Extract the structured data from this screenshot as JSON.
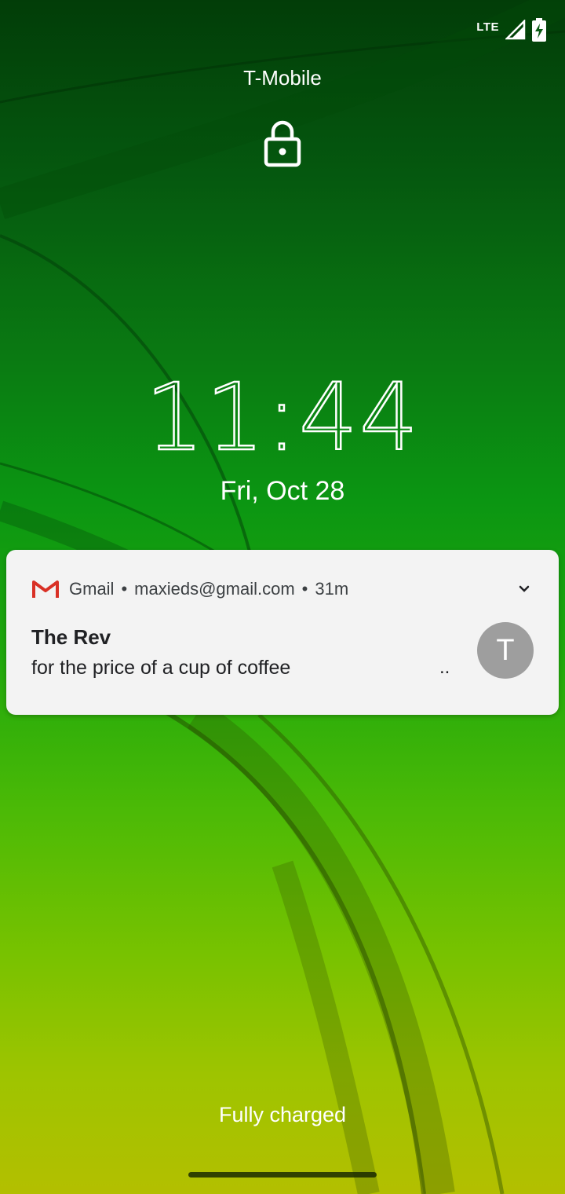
{
  "status_bar": {
    "network_type": "LTE",
    "signal_icon": "cell-signal-icon",
    "battery_icon": "battery-charging-icon"
  },
  "lockscreen": {
    "carrier": "T-Mobile",
    "lock_icon": "lock-icon",
    "time_hours": "11",
    "time_separator": ":",
    "time_minutes": "44",
    "date": "Fri, Oct 28",
    "charging_status": "Fully charged"
  },
  "notification": {
    "app_icon": "gmail-icon",
    "app_name": "Gmail",
    "separator": "•",
    "account": "maxieds@gmail.com",
    "time_ago": "31m",
    "expand_icon": "chevron-down-icon",
    "title": "The Rev",
    "body": "for the price of a cup of coffee",
    "ellipsis": "..",
    "avatar_letter": "T"
  },
  "colors": {
    "gmail_red": "#d93025",
    "avatar_bg": "#9e9e9e",
    "card_bg": "#f3f3f3"
  }
}
